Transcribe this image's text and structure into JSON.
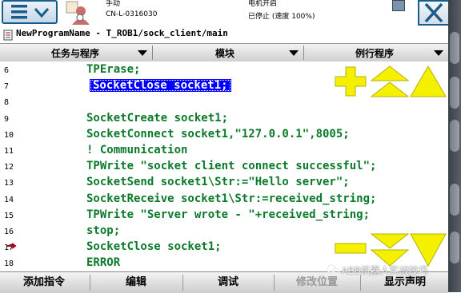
{
  "status": {
    "mode": "手动",
    "controller_id": "CN-L-0316030",
    "motor_state": "电机开启",
    "run_state": "已停止 (速度 100%)"
  },
  "title": "NewProgramName - T_ROB1/sock_client/main",
  "tabs": [
    {
      "label": "任务与程序"
    },
    {
      "label": "模块"
    },
    {
      "label": "例行程序"
    }
  ],
  "code_lines": [
    {
      "num": "6",
      "text": "TPErase;"
    },
    {
      "num": "7",
      "text": "SocketClose socket1;",
      "selected": true
    },
    {
      "num": "8",
      "text": ""
    },
    {
      "num": "9",
      "text": "SocketCreate socket1;"
    },
    {
      "num": "10",
      "text": "SocketConnect socket1,\"127.0.0.1\",8005;"
    },
    {
      "num": "11",
      "text": "! Communication"
    },
    {
      "num": "12",
      "text": "TPWrite \"socket client connect successful\";"
    },
    {
      "num": "13",
      "text": "SocketSend socket1\\Str:=\"Hello server\";"
    },
    {
      "num": "14",
      "text": "SocketReceive socket1\\Str:=received_string;"
    },
    {
      "num": "15",
      "text": "TPWrite \"Server wrote - \"+received_string;"
    },
    {
      "num": "16",
      "text": "stop;"
    },
    {
      "num": "17",
      "text": "SocketClose socket1;"
    },
    {
      "num": "18",
      "text": "ERROR"
    }
  ],
  "toolbar": {
    "add_instruction": "添加指令",
    "edit": "编辑",
    "debug": "调试",
    "modify_position": "修改位置",
    "show_declarations": "显示声明"
  },
  "watermark": "ABB机器人实战技巧",
  "colors": {
    "code_text": "#0a7a2a",
    "selection": "#0000ff",
    "control_yellow": "#f4f000"
  },
  "icons": {
    "menu": "hamburger-menu-icon",
    "close": "close-x-icon",
    "zoom_in": "plus-icon",
    "zoom_out": "minus-icon",
    "scroll_up": "triangle-up-icon",
    "scroll_down": "triangle-down-icon"
  }
}
